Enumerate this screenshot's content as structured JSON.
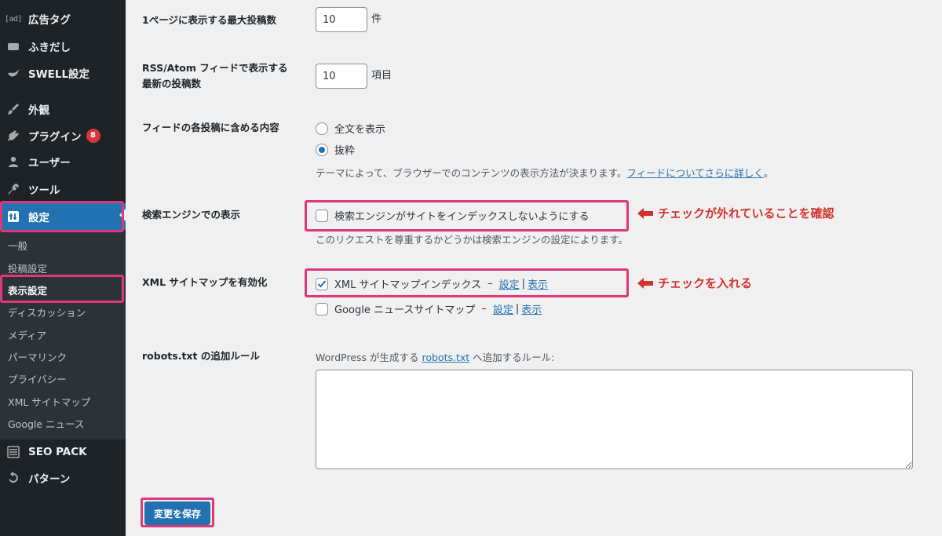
{
  "sidebar": {
    "items": [
      {
        "label": "広告タグ",
        "icon": "ad-icon",
        "icon_text": "[ad]"
      },
      {
        "label": "ふきだし",
        "icon": "speech-bubble-icon"
      },
      {
        "label": "SWELL設定",
        "icon": "swell-icon"
      },
      {
        "label": "外観",
        "icon": "paintbrush-icon"
      },
      {
        "label": "プラグイン",
        "icon": "plugin-icon",
        "badge": "8"
      },
      {
        "label": "ユーザー",
        "icon": "user-icon"
      },
      {
        "label": "ツール",
        "icon": "wrench-icon"
      },
      {
        "label": "設定",
        "icon": "settings-icon",
        "current": true
      },
      {
        "label": "SEO PACK",
        "icon": "list-icon"
      },
      {
        "label": "パターン",
        "icon": "undo-icon"
      }
    ],
    "submenu": [
      {
        "label": "一般"
      },
      {
        "label": "投稿設定"
      },
      {
        "label": "表示設定",
        "current": true
      },
      {
        "label": "ディスカッション"
      },
      {
        "label": "メディア"
      },
      {
        "label": "パーマリンク"
      },
      {
        "label": "プライバシー"
      },
      {
        "label": "XML サイトマップ"
      },
      {
        "label": "Google ニュース"
      }
    ]
  },
  "settings": {
    "posts_per_page": {
      "label": "1ページに表示する最大投稿数",
      "value": "10",
      "unit": "件"
    },
    "posts_per_rss": {
      "label_line1": "RSS/Atom フィードで表示する",
      "label_line2": "最新の投稿数",
      "value": "10",
      "unit": "項目"
    },
    "rss_content": {
      "label": "フィードの各投稿に含める内容",
      "options": [
        {
          "label": "全文を表示",
          "selected": false
        },
        {
          "label": "抜粋",
          "selected": true
        }
      ],
      "description": "テーマによって、ブラウザーでのコンテンツの表示方法が決まります。",
      "link": "フィードについてさらに詳しく",
      "description_end": "。"
    },
    "search_engine": {
      "label": "検索エンジンでの表示",
      "checkbox_label": "検索エンジンがサイトをインデックスしないようにする",
      "checked": false,
      "description": "このリクエストを尊重するかどうかは検索エンジンの設定によります。",
      "annotation": "チェックが外れていることを確認"
    },
    "xml_sitemap": {
      "label": "XML サイトマップを有効化",
      "items": [
        {
          "label": "XML サイトマップインデックス",
          "checked": true,
          "dash": "–",
          "link1": "設定",
          "sep": "|",
          "link2": "表示"
        },
        {
          "label": "Google ニュースサイトマップ",
          "checked": false,
          "dash": "–",
          "link1": "設定",
          "sep": "|",
          "link2": "表示"
        }
      ],
      "annotation": "チェックを入れる"
    },
    "robots": {
      "label": "robots.txt の追加ルール",
      "desc_prefix": "WordPress が生成する ",
      "link": "robots.txt",
      "desc_suffix": " へ追加するルール:",
      "value": ""
    }
  },
  "save_label": "変更を保存",
  "colors": {
    "accent": "#2271b1",
    "highlight": "#e0377a",
    "annotation": "#d1322c",
    "badge": "#d63638"
  }
}
